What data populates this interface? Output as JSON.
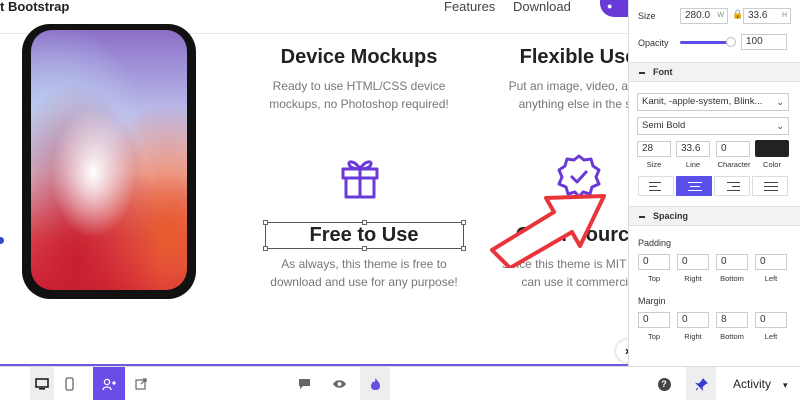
{
  "header": {
    "brand": "t Bootstrap",
    "nav": [
      "Features",
      "Download"
    ]
  },
  "features": [
    {
      "title": "Device Mockups",
      "desc": [
        "Ready to use HTML/CSS device",
        "mockups, no Photoshop required!"
      ]
    },
    {
      "title": "Flexible Use",
      "desc": [
        "Put an image, video, anim",
        "anything else in the sc"
      ]
    },
    {
      "title": "Free to Use",
      "desc": [
        "As always, this theme is free to",
        "download and use for any purpose!"
      ]
    },
    {
      "title": "Open Source",
      "desc": [
        "Since this theme is MIT licen",
        "can use it commercia"
      ]
    }
  ],
  "panel": {
    "size": {
      "label": "Size",
      "width": "280.0",
      "w_unit": "W",
      "height": "33.6",
      "h_unit": "H"
    },
    "opacity": {
      "label": "Opacity",
      "value": "100",
      "level": 1.0
    },
    "font_section": "Font",
    "font_family": "Kanit, -apple-system, Blink...",
    "font_weight": "Semi Bold",
    "font_size": {
      "value": "28",
      "label": "Size"
    },
    "line": {
      "value": "33.6",
      "label": "Line"
    },
    "character": {
      "value": "0",
      "label": "Character"
    },
    "color": {
      "label": "Color",
      "value": "#222222"
    },
    "text_align": "center",
    "spacing_section": "Spacing",
    "padding": {
      "label": "Padding",
      "values": [
        "0",
        "0",
        "0",
        "0"
      ],
      "sides": [
        "Top",
        "Right",
        "Bottom",
        "Left"
      ]
    },
    "margin": {
      "label": "Margin",
      "values": [
        "0",
        "0",
        "8",
        "0"
      ],
      "sides": [
        "Top",
        "Right",
        "Bottom",
        "Left"
      ]
    }
  },
  "bottombar": {
    "activity": "Activity"
  },
  "colors": {
    "accent": "#6a4ce6",
    "arrow": "#e8343a"
  }
}
